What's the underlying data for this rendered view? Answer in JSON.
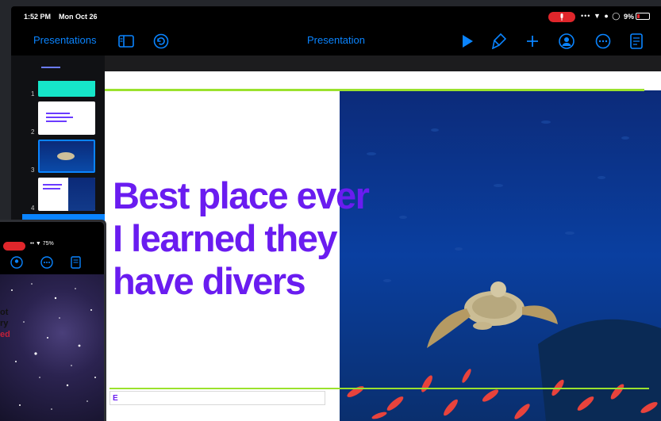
{
  "status": {
    "time": "1:52 PM",
    "date": "Mon Oct 26",
    "battery": "9%"
  },
  "toolbar": {
    "back_label": "Presentations",
    "title": "Presentation",
    "icons": [
      "sidebar-icon",
      "undo-icon",
      "play-icon",
      "format-brush-icon",
      "add-icon",
      "collaborate-icon",
      "more-icon",
      "document-icon"
    ]
  },
  "navigator": {
    "slides": [
      {
        "number": "1"
      },
      {
        "number": "2"
      },
      {
        "number": "3"
      },
      {
        "number": "4"
      }
    ]
  },
  "slide": {
    "headline": [
      "Best place ever",
      "I learned they",
      "have divers"
    ],
    "subtitle_fragment": "E"
  },
  "overlay": {
    "battery": "75%",
    "text_lines": [
      "ot",
      "ry",
      "ed"
    ]
  },
  "colors": {
    "accent": "#0a84ff",
    "headline": "#6a1cf0",
    "rule": "#9be22d",
    "record": "#e0262b"
  }
}
